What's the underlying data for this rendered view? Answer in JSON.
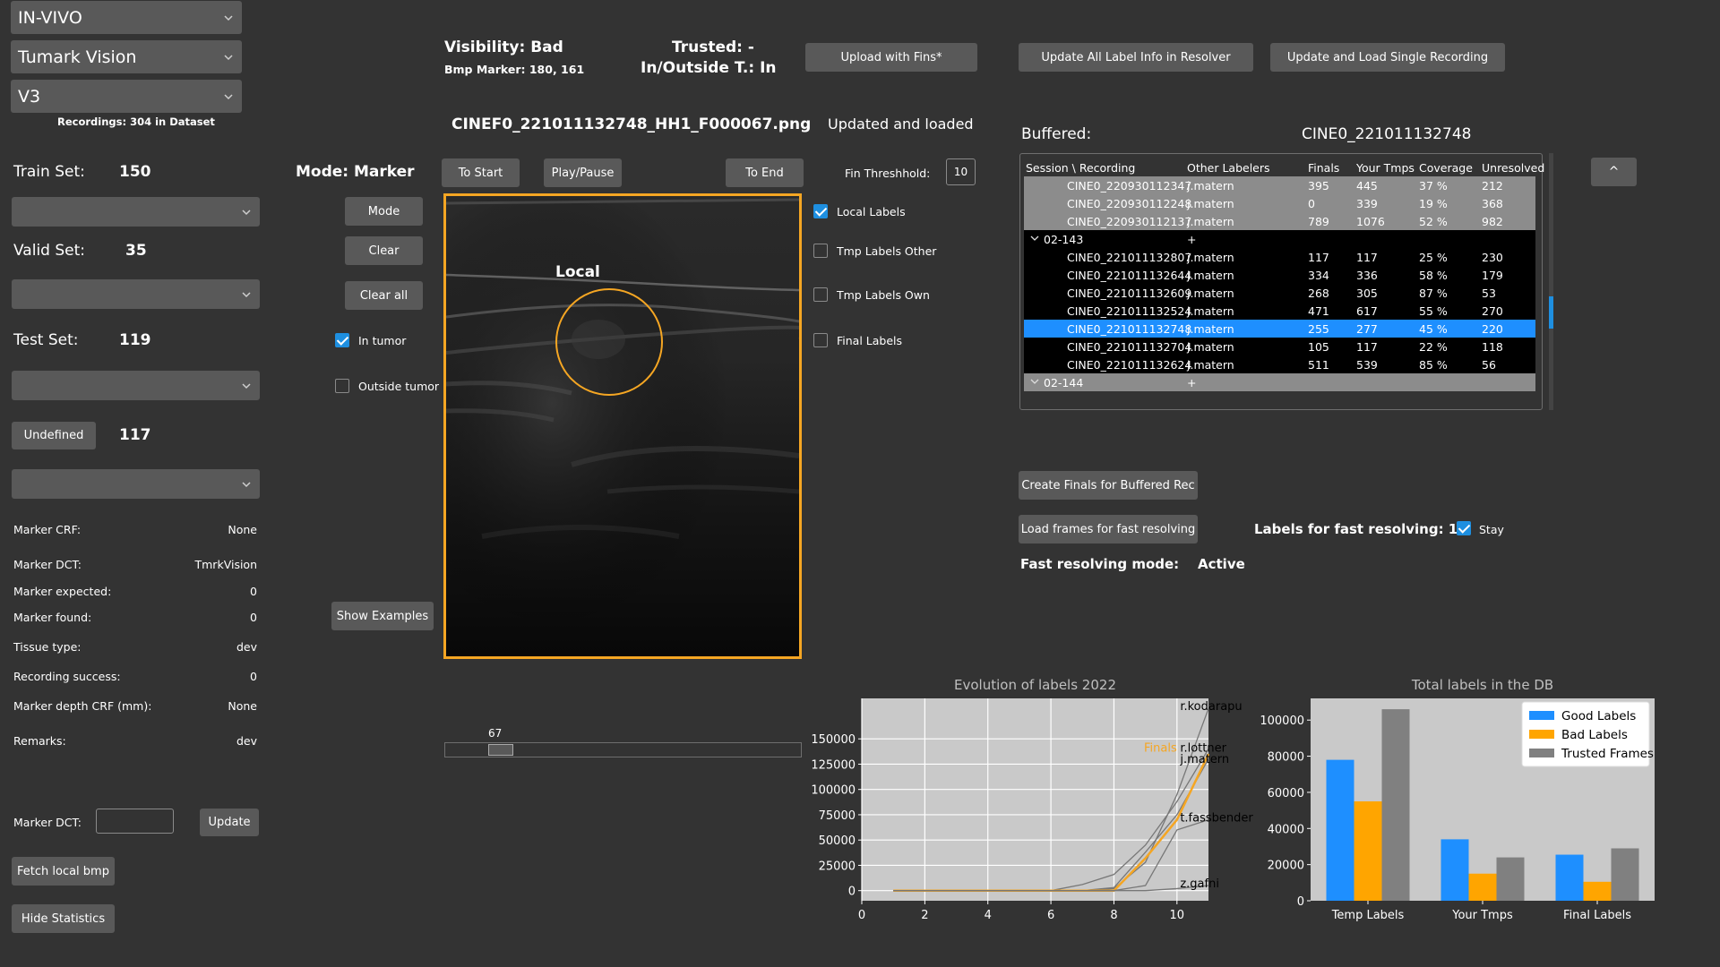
{
  "combos": {
    "source": "IN-VIVO",
    "device": "Tumark Vision",
    "version": "V3"
  },
  "recordings_info": "Recordings: 304 in Dataset",
  "sets": {
    "train_label": "Train Set:",
    "train_value": "150",
    "valid_label": "Valid Set:",
    "valid_value": "35",
    "test_label": "Test Set:",
    "test_value": "119",
    "undefined_label": "Undefined",
    "undefined_value": "117"
  },
  "marker_info": [
    {
      "key": "Marker CRF:",
      "value": "None"
    },
    {
      "key": "Marker DCT:",
      "value": "TmrkVision"
    },
    {
      "key": "Marker expected:",
      "value": "0"
    },
    {
      "key": "Marker found:",
      "value": "0"
    },
    {
      "key": "Tissue type:",
      "value": "dev"
    },
    {
      "key": "Recording success:",
      "value": "0"
    },
    {
      "key": "Marker depth CRF (mm):",
      "value": "None"
    },
    {
      "key": "Remarks:",
      "value": "dev"
    }
  ],
  "marker_dct": {
    "label": "Marker DCT:",
    "value": "",
    "update": "Update"
  },
  "left_buttons": {
    "fetch": "Fetch local bmp",
    "hide": "Hide Statistics"
  },
  "status": {
    "visibility": "Visibility: Bad",
    "bmp_marker": "Bmp Marker: 180, 161",
    "trusted": "Trusted: -",
    "in_outside": "In/Outside T.: In",
    "filename": "CINEF0_221011132748_HH1_F000067.png",
    "load_state": "Updated and loaded"
  },
  "top_buttons": {
    "upload": "Upload with Fins*",
    "update_all": "Update All Label Info in Resolver",
    "update_single": "Update and Load Single Recording"
  },
  "mode": {
    "title": "Mode: Marker",
    "mode_btn": "Mode",
    "clear_btn": "Clear",
    "clear_all_btn": "Clear all",
    "in_tumor": "In tumor",
    "in_tumor_checked": true,
    "outside_tumor": "Outside tumor",
    "outside_tumor_checked": false,
    "show_examples": "Show Examples"
  },
  "player": {
    "to_start": "To Start",
    "play_pause": "Play/Pause",
    "to_end": "To End",
    "fin_threshold_label": "Fin Threshhold:",
    "fin_threshold_value": "10",
    "frame_label": "Local",
    "slider_value": "67",
    "slider_fraction": 0.13
  },
  "label_toggles": [
    {
      "label": "Local Labels",
      "checked": true
    },
    {
      "label": "Tmp Labels Other",
      "checked": false
    },
    {
      "label": "Tmp Labels Own",
      "checked": false
    },
    {
      "label": "Final Labels",
      "checked": false
    }
  ],
  "buffered": {
    "label": "Buffered:",
    "recording": "CINE0_221011132748",
    "collapse_btn": "^",
    "columns": [
      "Session \\ Recording",
      "Other Labelers",
      "Finals",
      "Your Tmps",
      "Coverage",
      "Unresolved"
    ],
    "rows": [
      {
        "kind": "rec",
        "group": "grey",
        "name": "CINE0_220930112347",
        "labeler": "j.matern",
        "finals": "395",
        "tmps": "445",
        "coverage": "37 %",
        "unresolved": "212"
      },
      {
        "kind": "rec",
        "group": "grey",
        "name": "CINE0_220930112248",
        "labeler": "j.matern",
        "finals": "0",
        "tmps": "339",
        "coverage": "19 %",
        "unresolved": "368"
      },
      {
        "kind": "rec",
        "group": "grey",
        "name": "CINE0_220930112137",
        "labeler": "j.matern",
        "finals": "789",
        "tmps": "1076",
        "coverage": "52 %",
        "unresolved": "982"
      },
      {
        "kind": "session",
        "group": "black",
        "name": "02-143",
        "labeler": "+"
      },
      {
        "kind": "rec",
        "group": "black",
        "name": "CINE0_221011132807",
        "labeler": "j.matern",
        "finals": "117",
        "tmps": "117",
        "coverage": "25 %",
        "unresolved": "230"
      },
      {
        "kind": "rec",
        "group": "black",
        "name": "CINE0_221011132644",
        "labeler": "j.matern",
        "finals": "334",
        "tmps": "336",
        "coverage": "58 %",
        "unresolved": "179"
      },
      {
        "kind": "rec",
        "group": "black",
        "name": "CINE0_221011132609",
        "labeler": "j.matern",
        "finals": "268",
        "tmps": "305",
        "coverage": "87 %",
        "unresolved": "53"
      },
      {
        "kind": "rec",
        "group": "black",
        "name": "CINE0_221011132524",
        "labeler": "j.matern",
        "finals": "471",
        "tmps": "617",
        "coverage": "55 %",
        "unresolved": "270"
      },
      {
        "kind": "rec",
        "group": "selected",
        "name": "CINE0_221011132748",
        "labeler": "j.matern",
        "finals": "255",
        "tmps": "277",
        "coverage": "45 %",
        "unresolved": "220"
      },
      {
        "kind": "rec",
        "group": "black",
        "name": "CINE0_221011132704",
        "labeler": "j.matern",
        "finals": "105",
        "tmps": "117",
        "coverage": "22 %",
        "unresolved": "118"
      },
      {
        "kind": "rec",
        "group": "black",
        "name": "CINE0_221011132624",
        "labeler": "j.matern",
        "finals": "511",
        "tmps": "539",
        "coverage": "85 %",
        "unresolved": "56"
      },
      {
        "kind": "session",
        "group": "grey",
        "name": "02-144",
        "labeler": "+"
      }
    ]
  },
  "resolving": {
    "create_finals": "Create Finals for Buffered Rec",
    "load_frames": "Load frames for fast resolving",
    "labels_count": "Labels for fast resolving: 16",
    "stay": "Stay",
    "stay_checked": true,
    "mode_label": "Fast resolving mode:",
    "mode_value": "Active"
  },
  "colors": {
    "accent": "#1e8fe0",
    "orange": "#f5a623",
    "background": "#333333",
    "control": "#595959"
  },
  "chart_data": [
    {
      "type": "line",
      "title": "Evolution of labels 2022",
      "xlabel": "",
      "ylabel": "",
      "xlim": [
        0,
        11
      ],
      "ylim": [
        -10000,
        190000
      ],
      "xticks": [
        0,
        2,
        4,
        6,
        8,
        10
      ],
      "yticks": [
        0,
        25000,
        50000,
        75000,
        100000,
        125000,
        150000
      ],
      "grid": true,
      "series": [
        {
          "name": "r.kodarapu",
          "color": "#777777",
          "x": [
            1,
            2,
            3,
            4,
            5,
            6,
            7,
            8,
            9,
            10,
            11
          ],
          "y": [
            0,
            0,
            0,
            0,
            0,
            0,
            0,
            2000,
            28000,
            95000,
            180000
          ]
        },
        {
          "name": "r.lottner",
          "color": "#777777",
          "x": [
            1,
            2,
            3,
            4,
            5,
            6,
            7,
            8,
            9,
            10,
            11
          ],
          "y": [
            0,
            0,
            0,
            0,
            0,
            0,
            6000,
            16000,
            45000,
            88000,
            140000
          ]
        },
        {
          "name": "j.matern",
          "color": "#777777",
          "x": [
            1,
            2,
            3,
            4,
            5,
            6,
            7,
            8,
            9,
            10,
            11
          ],
          "y": [
            0,
            0,
            0,
            0,
            0,
            0,
            0,
            3000,
            38000,
            75000,
            130000
          ]
        },
        {
          "name": "Finals",
          "color": "#f5a623",
          "x": [
            1,
            2,
            3,
            4,
            5,
            6,
            7,
            8,
            9,
            10,
            11
          ],
          "y": [
            0,
            0,
            0,
            0,
            0,
            0,
            0,
            0,
            32000,
            70000,
            135000
          ]
        },
        {
          "name": "t.fassbender",
          "color": "#777777",
          "x": [
            1,
            2,
            3,
            4,
            5,
            6,
            7,
            8,
            9,
            10,
            11
          ],
          "y": [
            0,
            0,
            0,
            0,
            0,
            0,
            0,
            0,
            5000,
            60000,
            70000
          ]
        },
        {
          "name": "z.gafni",
          "color": "#777777",
          "x": [
            1,
            2,
            3,
            4,
            5,
            6,
            7,
            8,
            9,
            10,
            11
          ],
          "y": [
            0,
            0,
            0,
            0,
            0,
            0,
            0,
            0,
            0,
            2000,
            5000
          ]
        }
      ]
    },
    {
      "type": "bar",
      "title": "Total labels in the DB",
      "xlabel": "",
      "ylabel": "",
      "ylim": [
        0,
        112000
      ],
      "yticks": [
        0,
        20000,
        40000,
        60000,
        80000,
        100000
      ],
      "legend": "top-right",
      "categories": [
        "Temp Labels",
        "Your Tmps",
        "Final Labels"
      ],
      "series": [
        {
          "name": "Good Labels",
          "color": "#1e8fff",
          "values": [
            78000,
            34000,
            25500
          ]
        },
        {
          "name": "Bad Labels",
          "color": "#ffa500",
          "values": [
            55000,
            15000,
            10500
          ]
        },
        {
          "name": "Trusted Frames",
          "color": "#808080",
          "values": [
            106000,
            24000,
            29000
          ]
        }
      ]
    }
  ]
}
